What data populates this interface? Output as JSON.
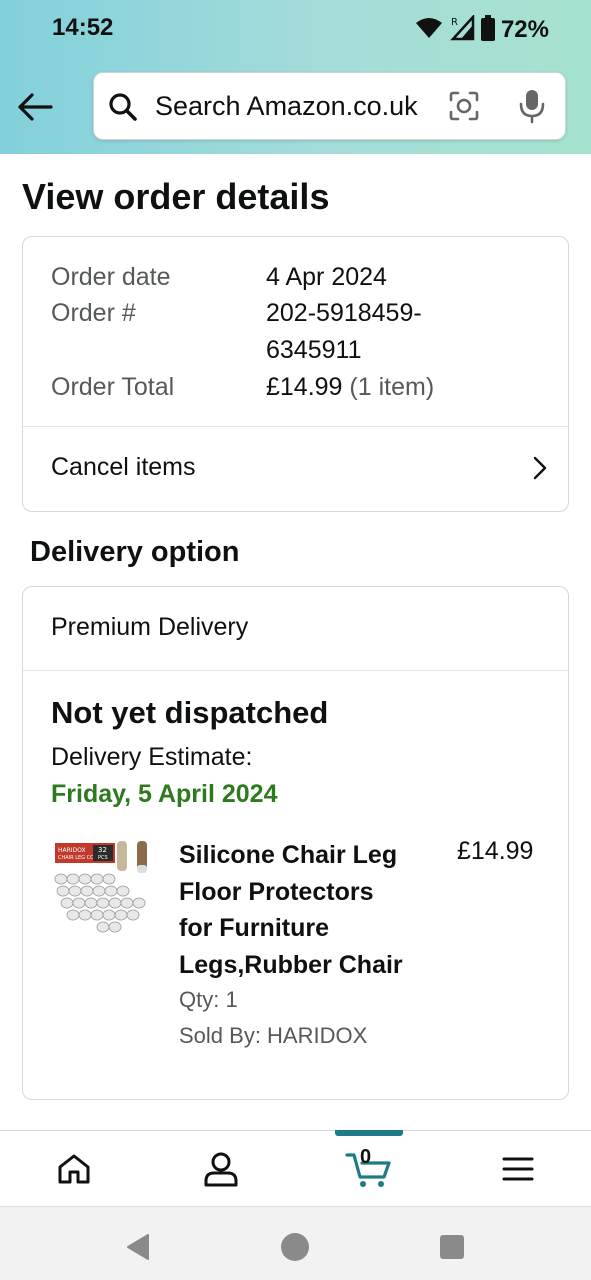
{
  "status_bar": {
    "time": "14:52",
    "battery": "72%"
  },
  "header": {
    "search_placeholder": "Search Amazon.co.uk"
  },
  "page": {
    "title": "View order details"
  },
  "order_summary": {
    "rows": [
      {
        "label": "Order date",
        "value": "4 Apr 2024"
      },
      {
        "label": "Order #",
        "value_line1": "202-5918459-",
        "value_line2": "6345911"
      },
      {
        "label": "Order Total",
        "value": "£14.99",
        "value_suffix": "(1 item)"
      }
    ],
    "cancel_label": "Cancel items"
  },
  "delivery": {
    "section_title": "Delivery option",
    "option": "Premium Delivery",
    "status": "Not yet dispatched",
    "estimate_label": "Delivery Estimate:",
    "estimate_date": "Friday, 5 April 2024"
  },
  "product": {
    "title_lines": [
      "Silicone Chair Leg",
      "Floor Protectors",
      "for Furniture",
      "Legs,Rubber Chair"
    ],
    "price": "£14.99",
    "qty": "Qty: 1",
    "seller": "Sold By: HARIDOX",
    "image_text": {
      "brand": "HARIDOX",
      "count": "32",
      "unit": "PCS",
      "caption": "CHAIR LEG COVERS"
    }
  },
  "bottom_nav": {
    "cart_count": "0"
  },
  "colors": {
    "header_gradient_start": "#82d0dc",
    "header_gradient_end": "#a6e2cf",
    "delivery_green": "#2d7a1f",
    "active_tab": "#1e7b86"
  }
}
